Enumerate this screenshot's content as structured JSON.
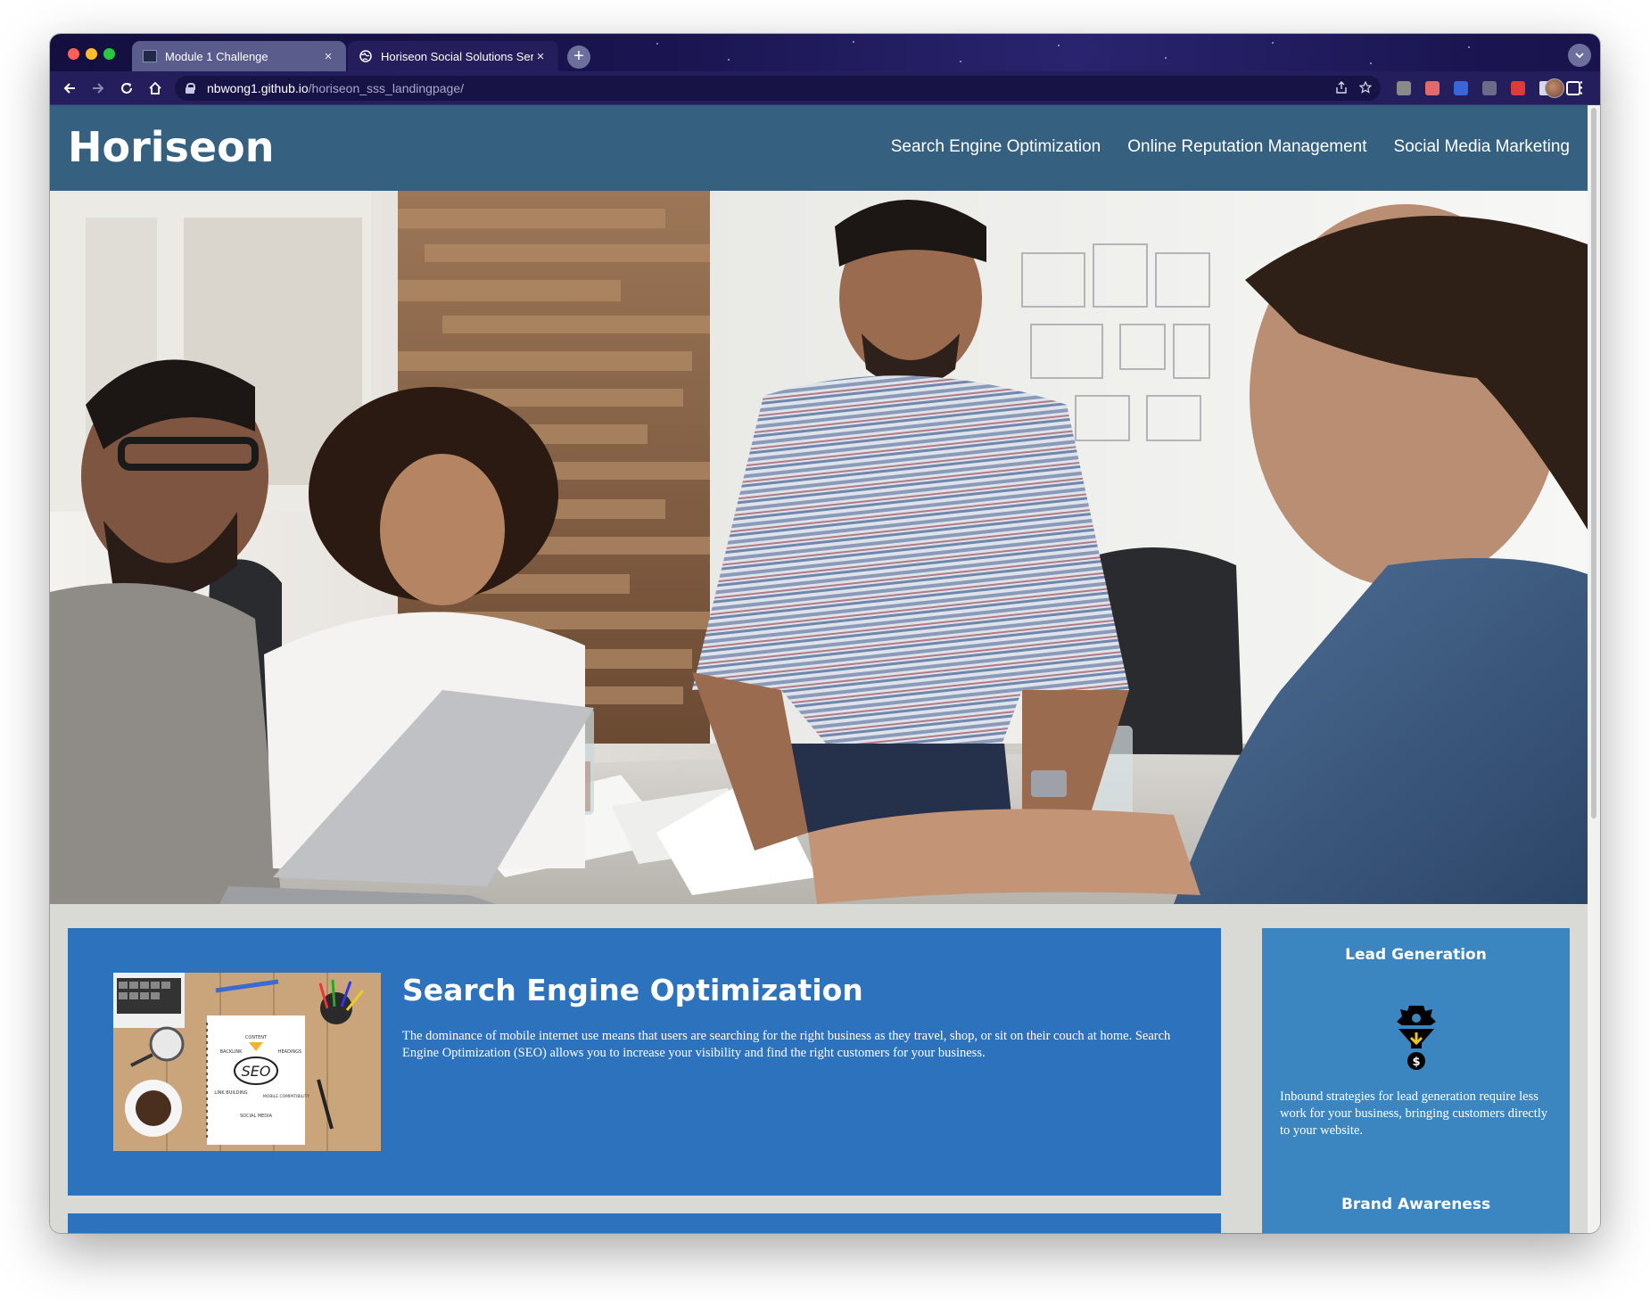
{
  "browser": {
    "tabs": [
      {
        "title": "Module 1 Challenge",
        "active": false
      },
      {
        "title": "Horiseon Social Solutions Serv",
        "active": true
      }
    ],
    "close_glyph": "×",
    "new_tab_glyph": "+",
    "url_host": "nbwong1.github.io",
    "url_path": "/horiseon_sss_landingpage/"
  },
  "site": {
    "logo": "Horiseon",
    "nav": [
      "Search Engine Optimization",
      "Online Reputation Management",
      "Social Media Marketing"
    ],
    "colors": {
      "header": "#35607f",
      "content_card": "#2d72bd",
      "sidebar": "#3b85c0",
      "page_bg": "#d9dad6"
    }
  },
  "content": {
    "seo": {
      "title": "Search Engine Optimization",
      "text": "The dominance of mobile internet use means that users are searching for the right business as they travel, shop, or sit on their couch at home. Search Engine Optimization (SEO) allows you to increase your visibility and find the right customers for your business.",
      "image_words": {
        "center": "SEO",
        "content": "CONTENT",
        "headings": "HEADINGS",
        "backlink": "BACKLINK",
        "link_building": "LINK BUILDING",
        "mobile": "MOBILE COMPATIBILITY",
        "social": "SOCIAL MEDIA"
      }
    }
  },
  "sidebar": {
    "lead_generation": {
      "title": "Lead Generation",
      "text": "Inbound strategies for lead generation require less work for your business, bringing customers directly to your website.",
      "icon": "funnel-dollar-icon"
    },
    "brand_awareness": {
      "title": "Brand Awareness"
    }
  }
}
